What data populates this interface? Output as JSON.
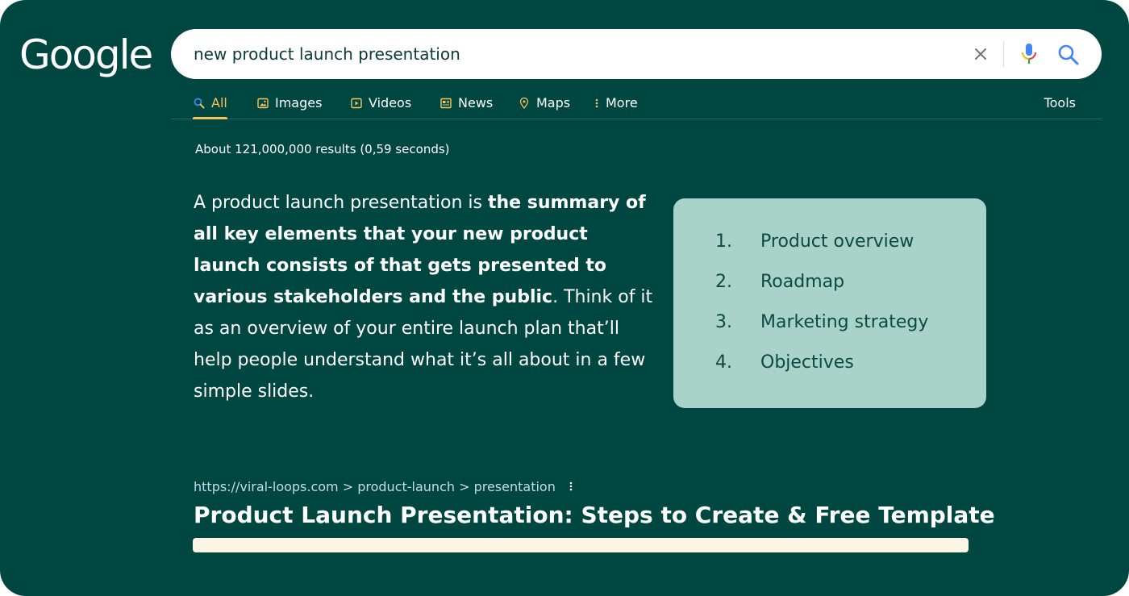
{
  "logo": {
    "text": "Google"
  },
  "search": {
    "query": "new product launch presentation",
    "clear_icon": "close-icon",
    "mic_icon": "microphone-icon",
    "search_icon": "search-icon"
  },
  "tabs": [
    {
      "label": "All",
      "icon": "search-icon",
      "active": true
    },
    {
      "label": "Images",
      "icon": "image-icon"
    },
    {
      "label": "Videos",
      "icon": "play-icon"
    },
    {
      "label": "News",
      "icon": "newspaper-icon"
    },
    {
      "label": "Maps",
      "icon": "map-pin-icon"
    },
    {
      "label": "More",
      "icon": "more-vertical-icon"
    }
  ],
  "tools": {
    "label": "Tools"
  },
  "result_stats": "About 121,000,000 results (0,59 seconds)",
  "snippet": {
    "pre": "A product launch presentation is ",
    "bold": "the summary of all key elements that your new product launch consists of that gets presented to various stakeholders and the public",
    "post": ". Think of it as an overview of your entire launch plan that’ll help people understand what it’s all about in a few simple slides."
  },
  "list": [
    {
      "num": "1.",
      "text": "Product overview"
    },
    {
      "num": "2.",
      "text": "Roadmap"
    },
    {
      "num": "3.",
      "text": "Marketing strategy"
    },
    {
      "num": "4.",
      "text": "Objectives"
    }
  ],
  "result": {
    "url": "https://viral-loops.com > product-launch > presentation",
    "title": "Product Launch Presentation: Steps to Create & Free Template"
  },
  "colors": {
    "background": "#004741",
    "accent": "#f6c35c",
    "card": "#a9d3c8",
    "highlight": "#fdf5e4"
  }
}
